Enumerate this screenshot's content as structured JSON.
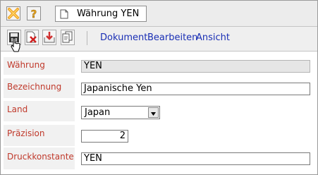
{
  "window": {
    "tab_title": "Währung YEN"
  },
  "toolbar": {
    "menus": [
      "Dokument",
      "Bearbeiten",
      "Ansicht"
    ]
  },
  "form": {
    "fields": [
      {
        "label": "Währung",
        "value": "YEN"
      },
      {
        "label": "Bezeichnung",
        "value": "Japanische Yen"
      },
      {
        "label": "Land",
        "value": "Japan"
      },
      {
        "label": "Präzision",
        "value": "2"
      },
      {
        "label": "Druckkonstante",
        "value": "YEN"
      }
    ]
  },
  "colors": {
    "label_text": "#c0392b",
    "menu_link": "#1a2fb5",
    "close_icon": "#f0a020"
  },
  "icons": [
    "close-icon",
    "help-icon",
    "document-icon",
    "save-icon",
    "delete-icon",
    "import-icon",
    "copy-icon",
    "cursor-icon"
  ]
}
